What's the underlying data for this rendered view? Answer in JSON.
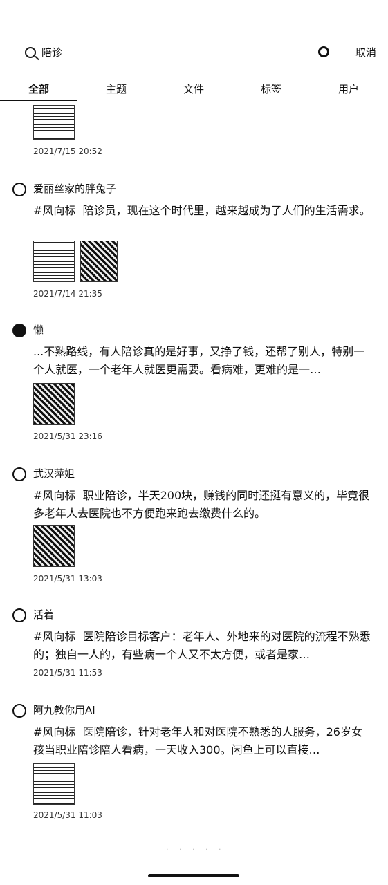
{
  "search": {
    "query": "陪诊",
    "cancel_label": "取消"
  },
  "tabs": [
    "全部",
    "主题",
    "文件",
    "标签",
    "用户"
  ],
  "top_item": {
    "date": "2021/7/15 20:52"
  },
  "posts": [
    {
      "author": "爱丽丝家的胖兔子",
      "content": "#风向标  陪诊员，现在这个时代里，越来越成为了人们的生活需求。",
      "date": "2021/7/14 21:35"
    },
    {
      "author": "懒",
      "content": "...不熟路线，有人陪诊真的是好事，又挣了钱，还帮了别人，特别一个人就医，一个老年人就医更需要。看病难，更难的是一…",
      "date": "2021/5/31 23:16"
    },
    {
      "author": "武汉萍姐",
      "content": "#风向标  职业陪诊，半天200块，赚钱的同时还挺有意义的，毕竟很多老年人去医院也不方便跑来跑去缴费什么的。",
      "date": "2021/5/31 13:03"
    },
    {
      "author": "活着",
      "content": "#风向标  医院陪诊目标客户：老年人、外地来的对医院的流程不熟悉的；独自一人的，有些病一个人又不太方便，或者是家…",
      "date": "2021/5/31 11:53"
    },
    {
      "author": "阿九教你用AI",
      "content": "#风向标  医院陪诊，针对老年人和对医院不熟悉的人服务，26岁女孩当职业陪诊陪人看病，一天收入300。闲鱼上可以直接…",
      "date": "2021/5/31 11:03"
    }
  ],
  "icons": {
    "search": "search-icon",
    "record": "record-icon"
  }
}
